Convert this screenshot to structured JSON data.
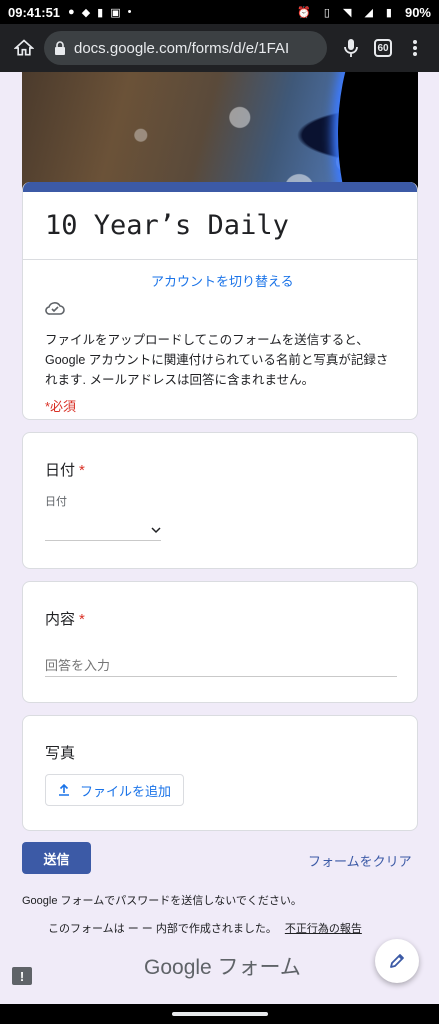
{
  "status_bar": {
    "time": "09:41:51",
    "battery": "90%"
  },
  "browser": {
    "url": "docs.google.com/forms/d/e/1FAI",
    "tab_count": "60"
  },
  "form": {
    "title": "10 Year’s Daily",
    "switch_account": "アカウントを切り替える",
    "upload_notice": "ファイルをアップロードしてこのフォームを送信すると、Google アカウントに関連付けられている名前と写真が記録されます. メールアドレスは回答に含まれません。",
    "required_note": "*必須"
  },
  "questions": {
    "date": {
      "title": "日付",
      "required": "*",
      "sub_label": "日付"
    },
    "content": {
      "title": "内容",
      "required": "*",
      "placeholder": "回答を入力"
    },
    "photo": {
      "title": "写真",
      "button": "ファイルを追加"
    }
  },
  "actions": {
    "submit": "送信",
    "clear": "フォームをクリア"
  },
  "footer": {
    "password_warning": "Google フォームでパスワードを送信しないでください。",
    "created_note": "このフォームは ー ー 内部で作成されました。",
    "abuse_link": "不正行為の報告",
    "logo": "Google フォーム"
  }
}
